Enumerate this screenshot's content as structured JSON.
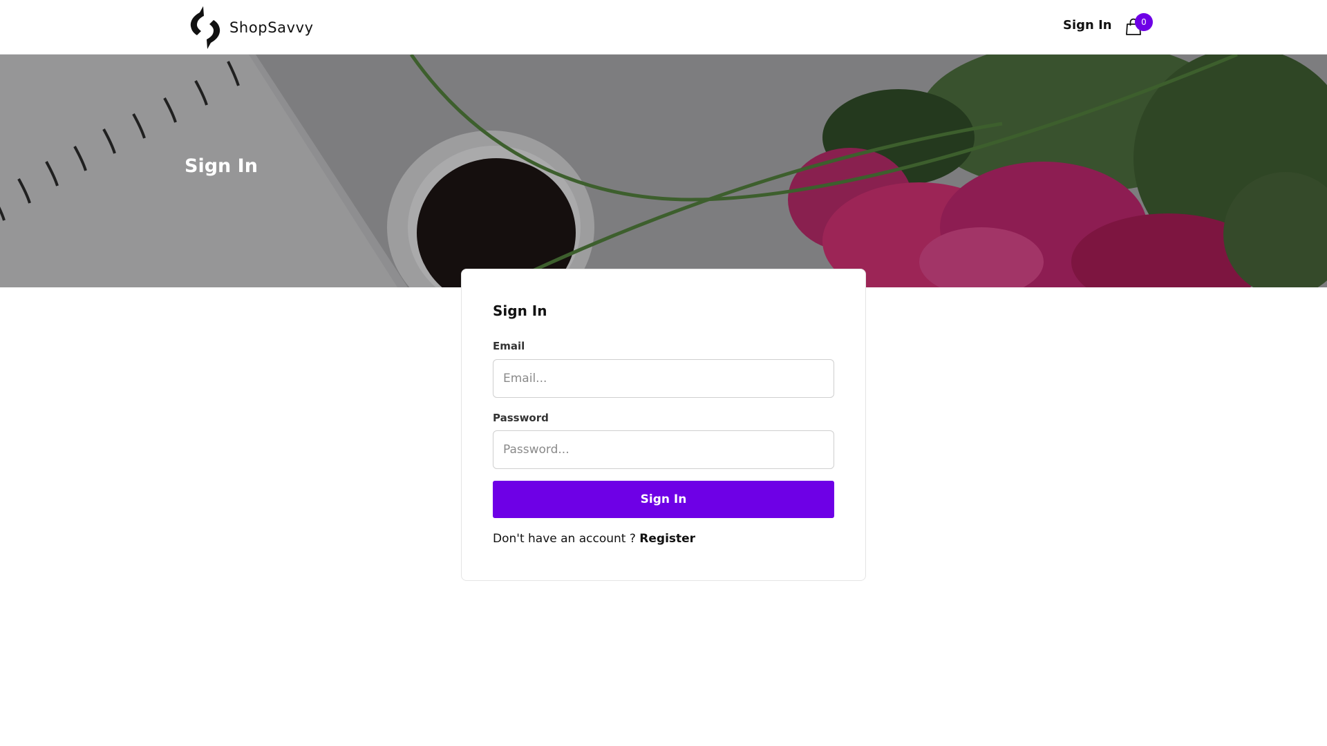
{
  "brand": {
    "name": "ShopSavvy",
    "accent": "#6e00e6"
  },
  "nav": {
    "signin_label": "Sign In",
    "cart": {
      "icon": "shopping-bag-icon",
      "count": "0"
    }
  },
  "hero": {
    "title": "Sign In"
  },
  "form": {
    "title": "Sign In",
    "email": {
      "label": "Email",
      "placeholder": "Email...",
      "value": ""
    },
    "password": {
      "label": "Password",
      "placeholder": "Password...",
      "value": ""
    },
    "submit_label": "Sign In",
    "register_prompt": "Don't have an account ?",
    "register_link": "Register"
  }
}
